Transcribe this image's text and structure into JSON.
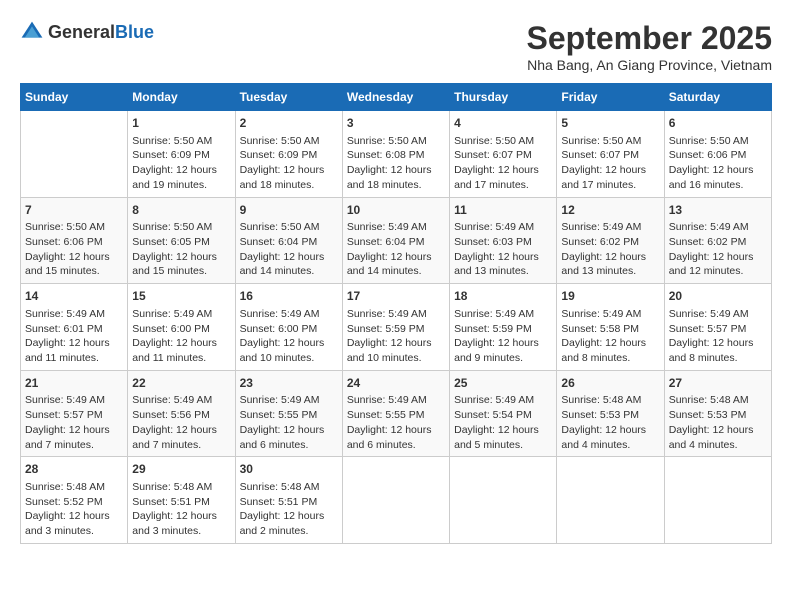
{
  "header": {
    "logo_general": "General",
    "logo_blue": "Blue",
    "title": "September 2025",
    "location": "Nha Bang, An Giang Province, Vietnam"
  },
  "days_of_week": [
    "Sunday",
    "Monday",
    "Tuesday",
    "Wednesday",
    "Thursday",
    "Friday",
    "Saturday"
  ],
  "weeks": [
    [
      {
        "day": "",
        "sunrise": "",
        "sunset": "",
        "daylight": ""
      },
      {
        "day": "1",
        "sunrise": "Sunrise: 5:50 AM",
        "sunset": "Sunset: 6:09 PM",
        "daylight": "Daylight: 12 hours and 19 minutes."
      },
      {
        "day": "2",
        "sunrise": "Sunrise: 5:50 AM",
        "sunset": "Sunset: 6:09 PM",
        "daylight": "Daylight: 12 hours and 18 minutes."
      },
      {
        "day": "3",
        "sunrise": "Sunrise: 5:50 AM",
        "sunset": "Sunset: 6:08 PM",
        "daylight": "Daylight: 12 hours and 18 minutes."
      },
      {
        "day": "4",
        "sunrise": "Sunrise: 5:50 AM",
        "sunset": "Sunset: 6:07 PM",
        "daylight": "Daylight: 12 hours and 17 minutes."
      },
      {
        "day": "5",
        "sunrise": "Sunrise: 5:50 AM",
        "sunset": "Sunset: 6:07 PM",
        "daylight": "Daylight: 12 hours and 17 minutes."
      },
      {
        "day": "6",
        "sunrise": "Sunrise: 5:50 AM",
        "sunset": "Sunset: 6:06 PM",
        "daylight": "Daylight: 12 hours and 16 minutes."
      }
    ],
    [
      {
        "day": "7",
        "sunrise": "Sunrise: 5:50 AM",
        "sunset": "Sunset: 6:06 PM",
        "daylight": "Daylight: 12 hours and 15 minutes."
      },
      {
        "day": "8",
        "sunrise": "Sunrise: 5:50 AM",
        "sunset": "Sunset: 6:05 PM",
        "daylight": "Daylight: 12 hours and 15 minutes."
      },
      {
        "day": "9",
        "sunrise": "Sunrise: 5:50 AM",
        "sunset": "Sunset: 6:04 PM",
        "daylight": "Daylight: 12 hours and 14 minutes."
      },
      {
        "day": "10",
        "sunrise": "Sunrise: 5:49 AM",
        "sunset": "Sunset: 6:04 PM",
        "daylight": "Daylight: 12 hours and 14 minutes."
      },
      {
        "day": "11",
        "sunrise": "Sunrise: 5:49 AM",
        "sunset": "Sunset: 6:03 PM",
        "daylight": "Daylight: 12 hours and 13 minutes."
      },
      {
        "day": "12",
        "sunrise": "Sunrise: 5:49 AM",
        "sunset": "Sunset: 6:02 PM",
        "daylight": "Daylight: 12 hours and 13 minutes."
      },
      {
        "day": "13",
        "sunrise": "Sunrise: 5:49 AM",
        "sunset": "Sunset: 6:02 PM",
        "daylight": "Daylight: 12 hours and 12 minutes."
      }
    ],
    [
      {
        "day": "14",
        "sunrise": "Sunrise: 5:49 AM",
        "sunset": "Sunset: 6:01 PM",
        "daylight": "Daylight: 12 hours and 11 minutes."
      },
      {
        "day": "15",
        "sunrise": "Sunrise: 5:49 AM",
        "sunset": "Sunset: 6:00 PM",
        "daylight": "Daylight: 12 hours and 11 minutes."
      },
      {
        "day": "16",
        "sunrise": "Sunrise: 5:49 AM",
        "sunset": "Sunset: 6:00 PM",
        "daylight": "Daylight: 12 hours and 10 minutes."
      },
      {
        "day": "17",
        "sunrise": "Sunrise: 5:49 AM",
        "sunset": "Sunset: 5:59 PM",
        "daylight": "Daylight: 12 hours and 10 minutes."
      },
      {
        "day": "18",
        "sunrise": "Sunrise: 5:49 AM",
        "sunset": "Sunset: 5:59 PM",
        "daylight": "Daylight: 12 hours and 9 minutes."
      },
      {
        "day": "19",
        "sunrise": "Sunrise: 5:49 AM",
        "sunset": "Sunset: 5:58 PM",
        "daylight": "Daylight: 12 hours and 8 minutes."
      },
      {
        "day": "20",
        "sunrise": "Sunrise: 5:49 AM",
        "sunset": "Sunset: 5:57 PM",
        "daylight": "Daylight: 12 hours and 8 minutes."
      }
    ],
    [
      {
        "day": "21",
        "sunrise": "Sunrise: 5:49 AM",
        "sunset": "Sunset: 5:57 PM",
        "daylight": "Daylight: 12 hours and 7 minutes."
      },
      {
        "day": "22",
        "sunrise": "Sunrise: 5:49 AM",
        "sunset": "Sunset: 5:56 PM",
        "daylight": "Daylight: 12 hours and 7 minutes."
      },
      {
        "day": "23",
        "sunrise": "Sunrise: 5:49 AM",
        "sunset": "Sunset: 5:55 PM",
        "daylight": "Daylight: 12 hours and 6 minutes."
      },
      {
        "day": "24",
        "sunrise": "Sunrise: 5:49 AM",
        "sunset": "Sunset: 5:55 PM",
        "daylight": "Daylight: 12 hours and 6 minutes."
      },
      {
        "day": "25",
        "sunrise": "Sunrise: 5:49 AM",
        "sunset": "Sunset: 5:54 PM",
        "daylight": "Daylight: 12 hours and 5 minutes."
      },
      {
        "day": "26",
        "sunrise": "Sunrise: 5:48 AM",
        "sunset": "Sunset: 5:53 PM",
        "daylight": "Daylight: 12 hours and 4 minutes."
      },
      {
        "day": "27",
        "sunrise": "Sunrise: 5:48 AM",
        "sunset": "Sunset: 5:53 PM",
        "daylight": "Daylight: 12 hours and 4 minutes."
      }
    ],
    [
      {
        "day": "28",
        "sunrise": "Sunrise: 5:48 AM",
        "sunset": "Sunset: 5:52 PM",
        "daylight": "Daylight: 12 hours and 3 minutes."
      },
      {
        "day": "29",
        "sunrise": "Sunrise: 5:48 AM",
        "sunset": "Sunset: 5:51 PM",
        "daylight": "Daylight: 12 hours and 3 minutes."
      },
      {
        "day": "30",
        "sunrise": "Sunrise: 5:48 AM",
        "sunset": "Sunset: 5:51 PM",
        "daylight": "Daylight: 12 hours and 2 minutes."
      },
      {
        "day": "",
        "sunrise": "",
        "sunset": "",
        "daylight": ""
      },
      {
        "day": "",
        "sunrise": "",
        "sunset": "",
        "daylight": ""
      },
      {
        "day": "",
        "sunrise": "",
        "sunset": "",
        "daylight": ""
      },
      {
        "day": "",
        "sunrise": "",
        "sunset": "",
        "daylight": ""
      }
    ]
  ]
}
